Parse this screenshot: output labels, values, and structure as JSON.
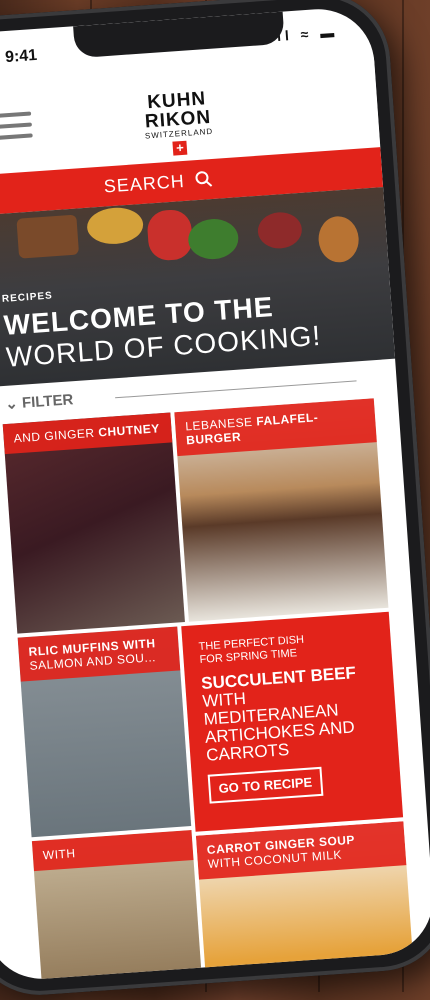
{
  "status": {
    "time": "9:41",
    "icons": "ııl ≈ ▬"
  },
  "brand": {
    "line1": "KUHN",
    "line2": "RIKON",
    "line3": "SWITZERLAND",
    "cross": "+"
  },
  "search": {
    "label": "SEARCH",
    "icon": "search-icon"
  },
  "hero": {
    "eyebrow": "RECIPES",
    "title_line1": "WELCOME TO THE",
    "title_line2": "WORLD OF COOKING!"
  },
  "filter": {
    "label": "FILTER"
  },
  "cards": [
    {
      "caption_pre": "AND GINGER ",
      "caption_bold": "CHUTNEY"
    },
    {
      "caption_pre": "LEBANESE ",
      "caption_bold": "FALAFEL-BURGER"
    },
    {
      "caption_pre": "RLIC MUFFINS WITH",
      "caption_bold": "",
      "caption_line2": "SALMON AND SOU..."
    },
    {
      "eyebrow_line1": "THE PERFECT DISH",
      "eyebrow_line2": "FOR SPRING TIME",
      "title_bold": "SUCCULENT BEEF",
      "title_rest": "WITH MEDITERANEAN ARTICHOKES AND CARROTS",
      "button": "GO TO RECIPE"
    },
    {
      "caption_pre": "WITH",
      "caption_bold": ""
    },
    {
      "caption_bold": "CARROT GINGER SOUP",
      "caption_line2": "WITH COCONUT MILK"
    }
  ],
  "colors": {
    "brand_red": "#e2231a"
  }
}
